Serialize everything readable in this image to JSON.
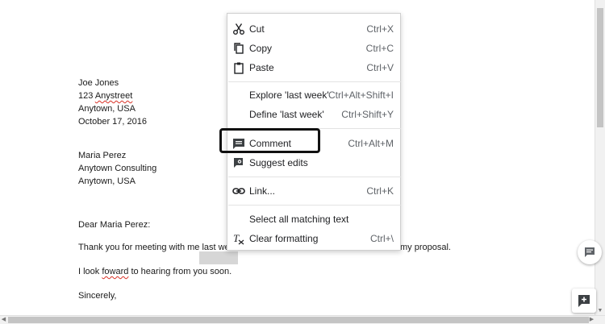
{
  "document": {
    "sender": [
      "Joe Jones",
      "123 Anystreet",
      "Anytown, USA",
      "October 17, 2016"
    ],
    "recipient": [
      "Maria Perez",
      "Anytown Consulting",
      "Anytown, USA"
    ],
    "salutation": "Dear Maria Perez:",
    "body1_prefix": "Thank you for meeting with me ",
    "body1_selected": "last we",
    "body1_suffix": "my proposal.",
    "body2_prefix": "I look ",
    "body2_misspelled": "foward",
    "body2_suffix": " to hearing from you soon.",
    "closing": "Sincerely,"
  },
  "context_menu": {
    "items": [
      {
        "icon": "scissors-icon",
        "label": "Cut",
        "shortcut": "Ctrl+X"
      },
      {
        "icon": "copy-icon",
        "label": "Copy",
        "shortcut": "Ctrl+C"
      },
      {
        "icon": "paste-icon",
        "label": "Paste",
        "shortcut": "Ctrl+V"
      },
      {
        "icon": "",
        "label": "Explore 'last week'",
        "shortcut": "Ctrl+Alt+Shift+I"
      },
      {
        "icon": "",
        "label": "Define 'last week'",
        "shortcut": "Ctrl+Shift+Y"
      },
      {
        "icon": "comment-icon",
        "label": "Comment",
        "shortcut": "Ctrl+Alt+M"
      },
      {
        "icon": "suggest-edits-icon",
        "label": "Suggest edits",
        "shortcut": ""
      },
      {
        "icon": "link-icon",
        "label": "Link...",
        "shortcut": "Ctrl+K"
      },
      {
        "icon": "",
        "label": "Select all matching text",
        "shortcut": ""
      },
      {
        "icon": "clear-formatting-icon",
        "label": "Clear formatting",
        "shortcut": "Ctrl+\\"
      }
    ]
  },
  "colors": {
    "spellcheck_underline": "#d93025",
    "selection": "#d6d6d6",
    "highlight_box": "#111111"
  }
}
